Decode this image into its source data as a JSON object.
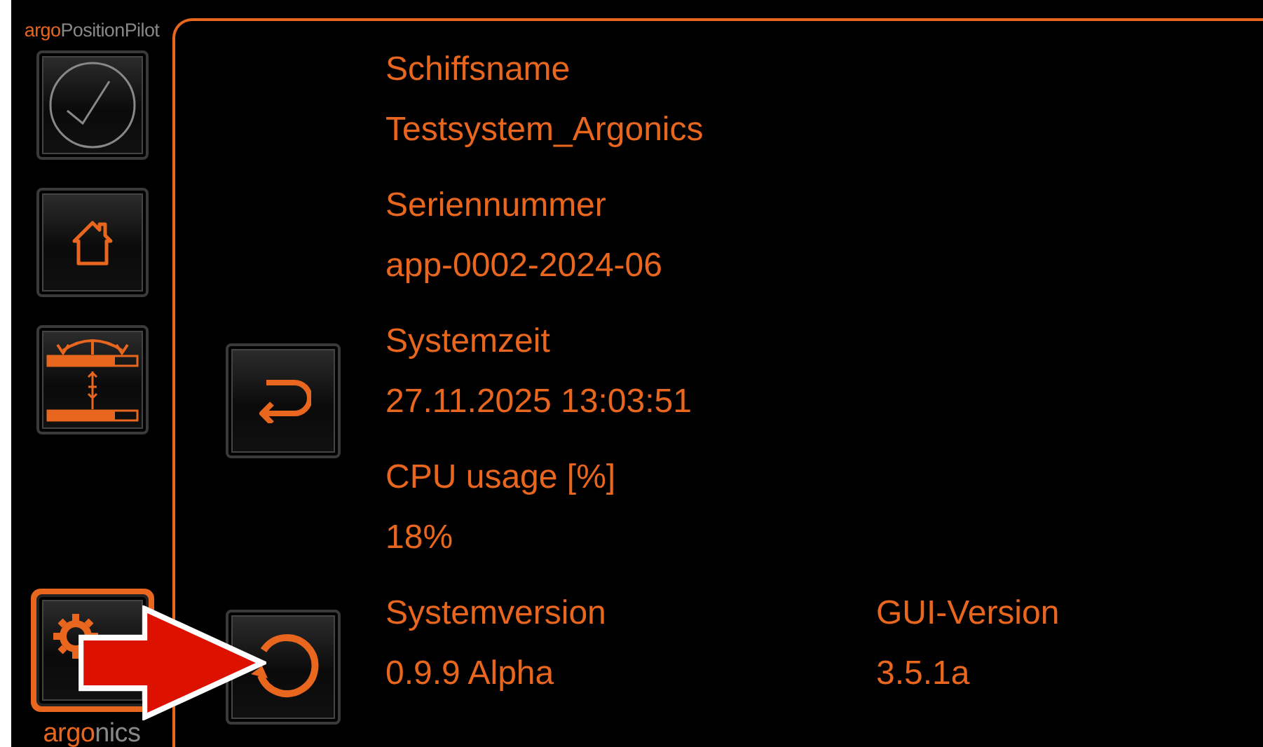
{
  "sidebar": {
    "logo": {
      "accent": "argo",
      "rest": "PositionPilot"
    },
    "items": [
      {
        "kind": "check",
        "selected": false
      },
      {
        "kind": "home",
        "selected": false
      },
      {
        "kind": "level",
        "selected": false
      },
      {
        "kind": "settings",
        "selected": true
      }
    ],
    "footer_logo": {
      "accent": "argo",
      "rest": "nics"
    }
  },
  "info": [
    {
      "label": "Schiffsname",
      "value": "Testsystem_Argonics"
    },
    {
      "label": "Seriennummer",
      "value": "app-0002-2024-06"
    },
    {
      "label": "Systemzeit",
      "value": "27.11.2025 13:03:51"
    },
    {
      "label": "CPU usage [%]",
      "value": "18%"
    },
    {
      "label": "Systemversion",
      "value": "0.9.9 Alpha"
    },
    {
      "label": "GUI-Version",
      "value": "3.5.1a"
    }
  ],
  "actions": [
    {
      "kind": "back"
    },
    {
      "kind": "restart"
    }
  ]
}
